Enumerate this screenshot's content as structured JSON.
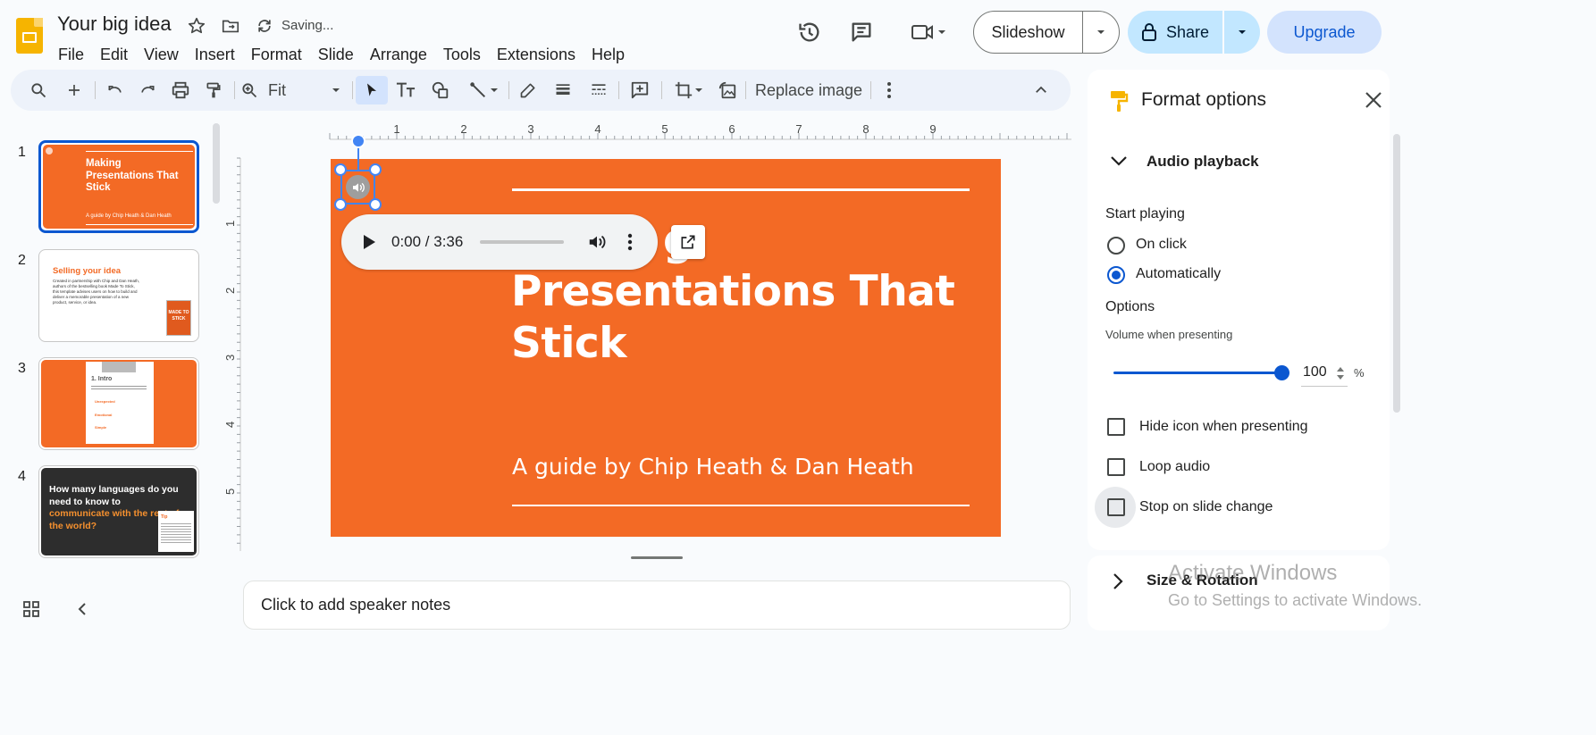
{
  "header": {
    "doc_title": "Your big idea",
    "saving_status": "Saving...",
    "menu": [
      "File",
      "Edit",
      "View",
      "Insert",
      "Format",
      "Slide",
      "Arrange",
      "Tools",
      "Extensions",
      "Help"
    ],
    "slideshow_label": "Slideshow",
    "share_label": "Share",
    "upgrade_label": "Upgrade"
  },
  "toolbar": {
    "zoom_value": "Fit",
    "replace_image_label": "Replace image"
  },
  "filmstrip": {
    "slides": [
      {
        "number": "1",
        "title": "Making Presentations That Stick",
        "subtitle": "A guide by Chip Heath & Dan Heath"
      },
      {
        "number": "2",
        "title": "Selling your idea",
        "body": "Created in partnership with Chip and Dan Heath, authors of the bestselling book Made To Stick, this template advises users on how to build and deliver a memorable presentation of a new product, service, or idea.",
        "book": "MADE TO STICK"
      },
      {
        "number": "3",
        "title": "1. Intro",
        "bullets": [
          "Unexpected",
          "Emotional",
          "Simple"
        ]
      },
      {
        "number": "4",
        "title_part1": "How many languages do you need to know to",
        "title_part2": "communicate with the rest of the world?",
        "tip": "Tip"
      }
    ]
  },
  "ruler": {
    "top_ticks": [
      "1",
      "2",
      "3",
      "4",
      "5",
      "6",
      "7",
      "8",
      "9"
    ],
    "left_ticks": [
      "1",
      "2",
      "3",
      "4",
      "5"
    ]
  },
  "slide": {
    "title": "Presentations That Stick",
    "hidden_title_fragment": "g",
    "subtitle": "A guide by Chip Heath & Dan Heath",
    "background": "#f36a25"
  },
  "audio_player": {
    "time": "0:00 / 3:36",
    "progress": 0
  },
  "notes": {
    "placeholder": "Click to add speaker notes"
  },
  "format_panel": {
    "title": "Format options",
    "audio_section": "Audio playback",
    "start_playing_label": "Start playing",
    "start_options": [
      {
        "label": "On click",
        "checked": false
      },
      {
        "label": "Automatically",
        "checked": true
      }
    ],
    "options_label": "Options",
    "volume_label": "Volume when presenting",
    "volume_value": "100",
    "volume_unit": "%",
    "checkboxes": [
      {
        "label": "Hide icon when presenting",
        "checked": false
      },
      {
        "label": "Loop audio",
        "checked": false
      },
      {
        "label": "Stop on slide change",
        "checked": false
      }
    ],
    "size_section": "Size & Rotation"
  },
  "watermark": {
    "line1": "Activate Windows",
    "line2": "Go to Settings to activate Windows."
  },
  "colors": {
    "accent": "#0b57d0",
    "share_bg": "#c2e7ff",
    "upgrade_bg": "#d3e3fd",
    "slide_orange": "#f36a25",
    "logo_yellow": "#f6b400"
  }
}
